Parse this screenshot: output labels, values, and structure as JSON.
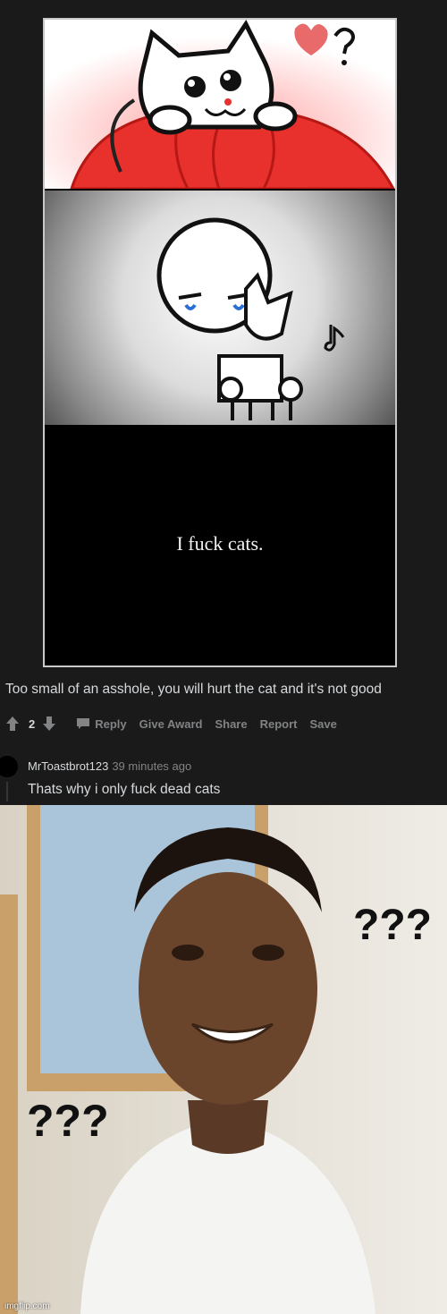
{
  "comic": {
    "caption": "I fuck cats."
  },
  "comment": {
    "text": "Too small of an asshole, you will hurt the cat and it's not good",
    "score": "2",
    "actions": {
      "reply": "Reply",
      "give_award": "Give Award",
      "share": "Share",
      "report": "Report",
      "save": "Save"
    }
  },
  "reply": {
    "username": "MrToastbrot123",
    "time": "39 minutes ago",
    "text": "Thats why i only fuck dead cats"
  },
  "meme": {
    "question_marks_left": "???",
    "question_marks_right": "???",
    "watermark": "imgflip.com"
  },
  "colors": {
    "background": "#1a1a1b",
    "text": "#d7dadc",
    "muted": "#818384"
  }
}
